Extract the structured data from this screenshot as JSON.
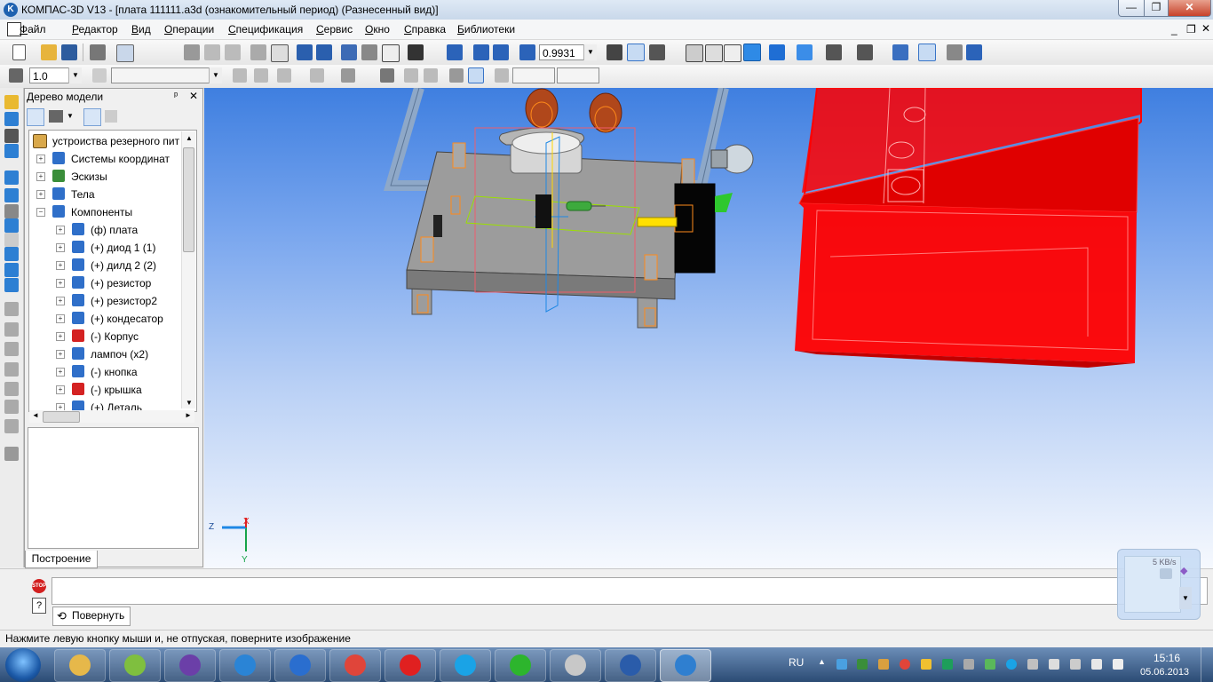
{
  "title_bar": {
    "title": "КОМПАС-3D V13 - [плата 111111.a3d (ознакомительный период) (Разнесенный вид)]",
    "app_icon_letter": "K",
    "minimize": "—",
    "maximize": "❐",
    "close": "✕"
  },
  "menu": {
    "items": [
      "Файл",
      "Редактор",
      "Вид",
      "Операции",
      "Спецификация",
      "Сервис",
      "Окно",
      "Справка",
      "Библиотеки"
    ],
    "mdi_min": "_",
    "mdi_restore": "❐",
    "mdi_close": "✕"
  },
  "toolbar1": {
    "zoom_value": "0.9931"
  },
  "toolbar2": {
    "step_value": "1.0",
    "style_value": ""
  },
  "model_tree": {
    "title": "Дерево модели",
    "pin": "ᵖ",
    "close": "✕",
    "root": "устроиства резерного пит",
    "items": [
      {
        "label": "Системы координат",
        "level": 1,
        "icon": "coordinate-systems-icon",
        "color": "#2f6fc9"
      },
      {
        "label": "Эскизы",
        "level": 1,
        "icon": "sketches-icon",
        "color": "#3a8e3a"
      },
      {
        "label": "Тела",
        "level": 1,
        "icon": "bodies-icon",
        "color": "#2f6fc9"
      },
      {
        "label": "Компоненты",
        "level": 1,
        "icon": "components-icon",
        "color": "#2f6fc9"
      },
      {
        "label": "(ф) плата",
        "level": 2,
        "icon": "part-icon",
        "color": "#2f6fc9"
      },
      {
        "label": "(+) диод 1 (1)",
        "level": 2,
        "icon": "part-icon",
        "color": "#2f6fc9"
      },
      {
        "label": "(+) дилд 2 (2)",
        "level": 2,
        "icon": "part-icon",
        "color": "#2f6fc9"
      },
      {
        "label": "(+) резистор",
        "level": 2,
        "icon": "part-icon",
        "color": "#2f6fc9"
      },
      {
        "label": "(+) резистор2",
        "level": 2,
        "icon": "part-icon",
        "color": "#2f6fc9"
      },
      {
        "label": "(+) кондесатор",
        "level": 2,
        "icon": "part-icon",
        "color": "#2f6fc9"
      },
      {
        "label": "(-) Корпус",
        "level": 2,
        "icon": "part-error-icon",
        "color": "#d42222"
      },
      {
        "label": "лампоч (x2)",
        "level": 2,
        "icon": "part-icon",
        "color": "#2f6fc9"
      },
      {
        "label": "(-) кнопка",
        "level": 2,
        "icon": "part-icon",
        "color": "#2f6fc9"
      },
      {
        "label": "(-) крышка",
        "level": 2,
        "icon": "part-error-icon",
        "color": "#d42222"
      },
      {
        "label": "(+) Деталь",
        "level": 2,
        "icon": "part-icon",
        "color": "#2f6fc9"
      }
    ],
    "tab_label": "Построение"
  },
  "viewport": {
    "axis_x": "X",
    "axis_y": "Y",
    "axis_z": "Z",
    "red_part_color": "#ff0000",
    "board_color": "#9c9c9c"
  },
  "command": {
    "stop_label": "STOP",
    "help_label": "?",
    "rotate_icon": "⟲",
    "rotate_label": "Повернуть"
  },
  "net_widget": {
    "speed": "5 KB/s"
  },
  "status": {
    "text": "Нажмите левую кнопку мыши и, не отпуская, поверните изображение"
  },
  "taskbar": {
    "apps": [
      {
        "name": "explorer-icon",
        "color": "#e6b84a",
        "active": false
      },
      {
        "name": "colorful-ball-icon",
        "color": "#7fbf3f",
        "active": false
      },
      {
        "name": "visual-studio-icon",
        "color": "#6b3fa8",
        "active": false
      },
      {
        "name": "internet-explorer-icon",
        "color": "#2a84d6",
        "active": false
      },
      {
        "name": "mail-ru-agent-icon",
        "color": "#2a6ecf",
        "active": false
      },
      {
        "name": "chrome-icon",
        "color": "#e0453a",
        "active": false
      },
      {
        "name": "yandex-icon",
        "color": "#e02020",
        "active": false
      },
      {
        "name": "skype-icon",
        "color": "#1aa3e6",
        "active": false
      },
      {
        "name": "mail-agent-icon",
        "color": "#2db52d",
        "active": false
      },
      {
        "name": "clock-app-icon",
        "color": "#c8c8c8",
        "active": false
      },
      {
        "name": "word-icon",
        "color": "#2a5caa",
        "active": false
      },
      {
        "name": "kompas-icon",
        "color": "#2f7fd0",
        "active": true
      }
    ],
    "lang": "RU",
    "time": "15:16",
    "date": "05.06.2013"
  }
}
